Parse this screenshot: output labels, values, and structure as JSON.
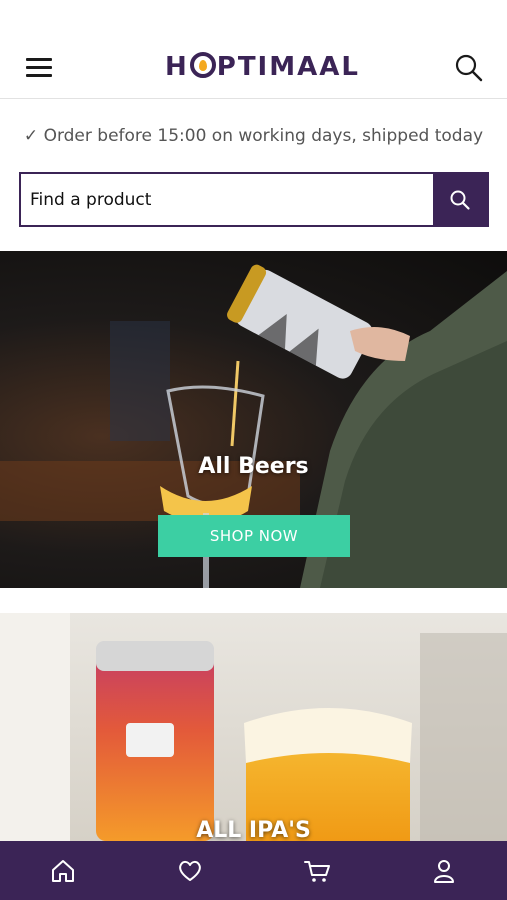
{
  "header": {
    "logo_text_left": "H",
    "logo_text_right": "PTIMAAL",
    "menu_icon": "hamburger-menu-icon",
    "search_icon": "search-icon"
  },
  "shipping_notice": "✓ Order before 15:00 on working days, shipped today",
  "search": {
    "placeholder": "Find a product",
    "value": "",
    "submit_icon": "search-icon"
  },
  "banners": [
    {
      "title": "All Beers",
      "button_label": "SHOP NOW"
    },
    {
      "title": "ALL IPA'S"
    }
  ],
  "bottom_nav": [
    {
      "icon": "home-icon"
    },
    {
      "icon": "heart-icon"
    },
    {
      "icon": "cart-icon"
    },
    {
      "icon": "user-icon"
    }
  ],
  "colors": {
    "brand": "#3b2456",
    "accent": "#3ccfa3",
    "logo_flame": "#f4a91f"
  }
}
